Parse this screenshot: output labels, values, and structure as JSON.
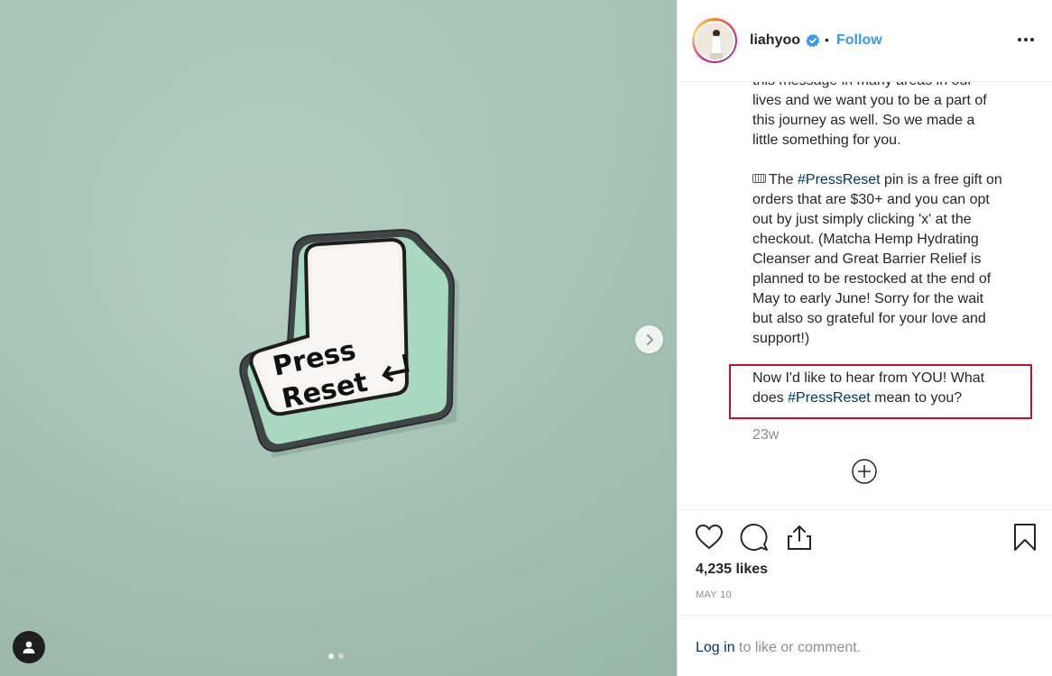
{
  "post": {
    "username": "liahyoo",
    "separator": "•",
    "follow_label": "Follow",
    "more_icon": "more-horizontal-icon",
    "verified_icon": "verified-badge-icon"
  },
  "photo": {
    "pin_line1": "Press",
    "pin_line2": "Reset",
    "carousel_index": 1,
    "carousel_total": 2
  },
  "caption": {
    "para1": [
      "this message in many areas in our",
      "lives and we want you to be a part of",
      "this journey as well. So we made a",
      "little something for you."
    ],
    "para2_emoji": "keyboard-emoji",
    "para2_prefix": "The ",
    "para2_tag": "#PressReset",
    "para2_line1_rest": " pin is a free gift on",
    "para2_rest": [
      "orders that are $30+ and you can opt",
      "out by just simply clicking 'x' at the",
      "checkout. (Matcha Hemp Hydrating",
      "Cleanser and Great Barrier Relief is",
      "planned to be restocked at the end of",
      "May to early June! Sorry for the wait",
      "but also so grateful for your love and",
      "support!)"
    ],
    "para3_line1": "Now I'd like to hear from YOU! What",
    "para3_line2_prefix": "does ",
    "para3_tag": "#PressReset",
    "para3_line2_rest": " mean to you?",
    "time": "23w"
  },
  "actions": {
    "likes": "4,235 likes",
    "date": "MAY 10"
  },
  "comment": {
    "login_label": "Log in",
    "login_rest": " to like or comment."
  }
}
